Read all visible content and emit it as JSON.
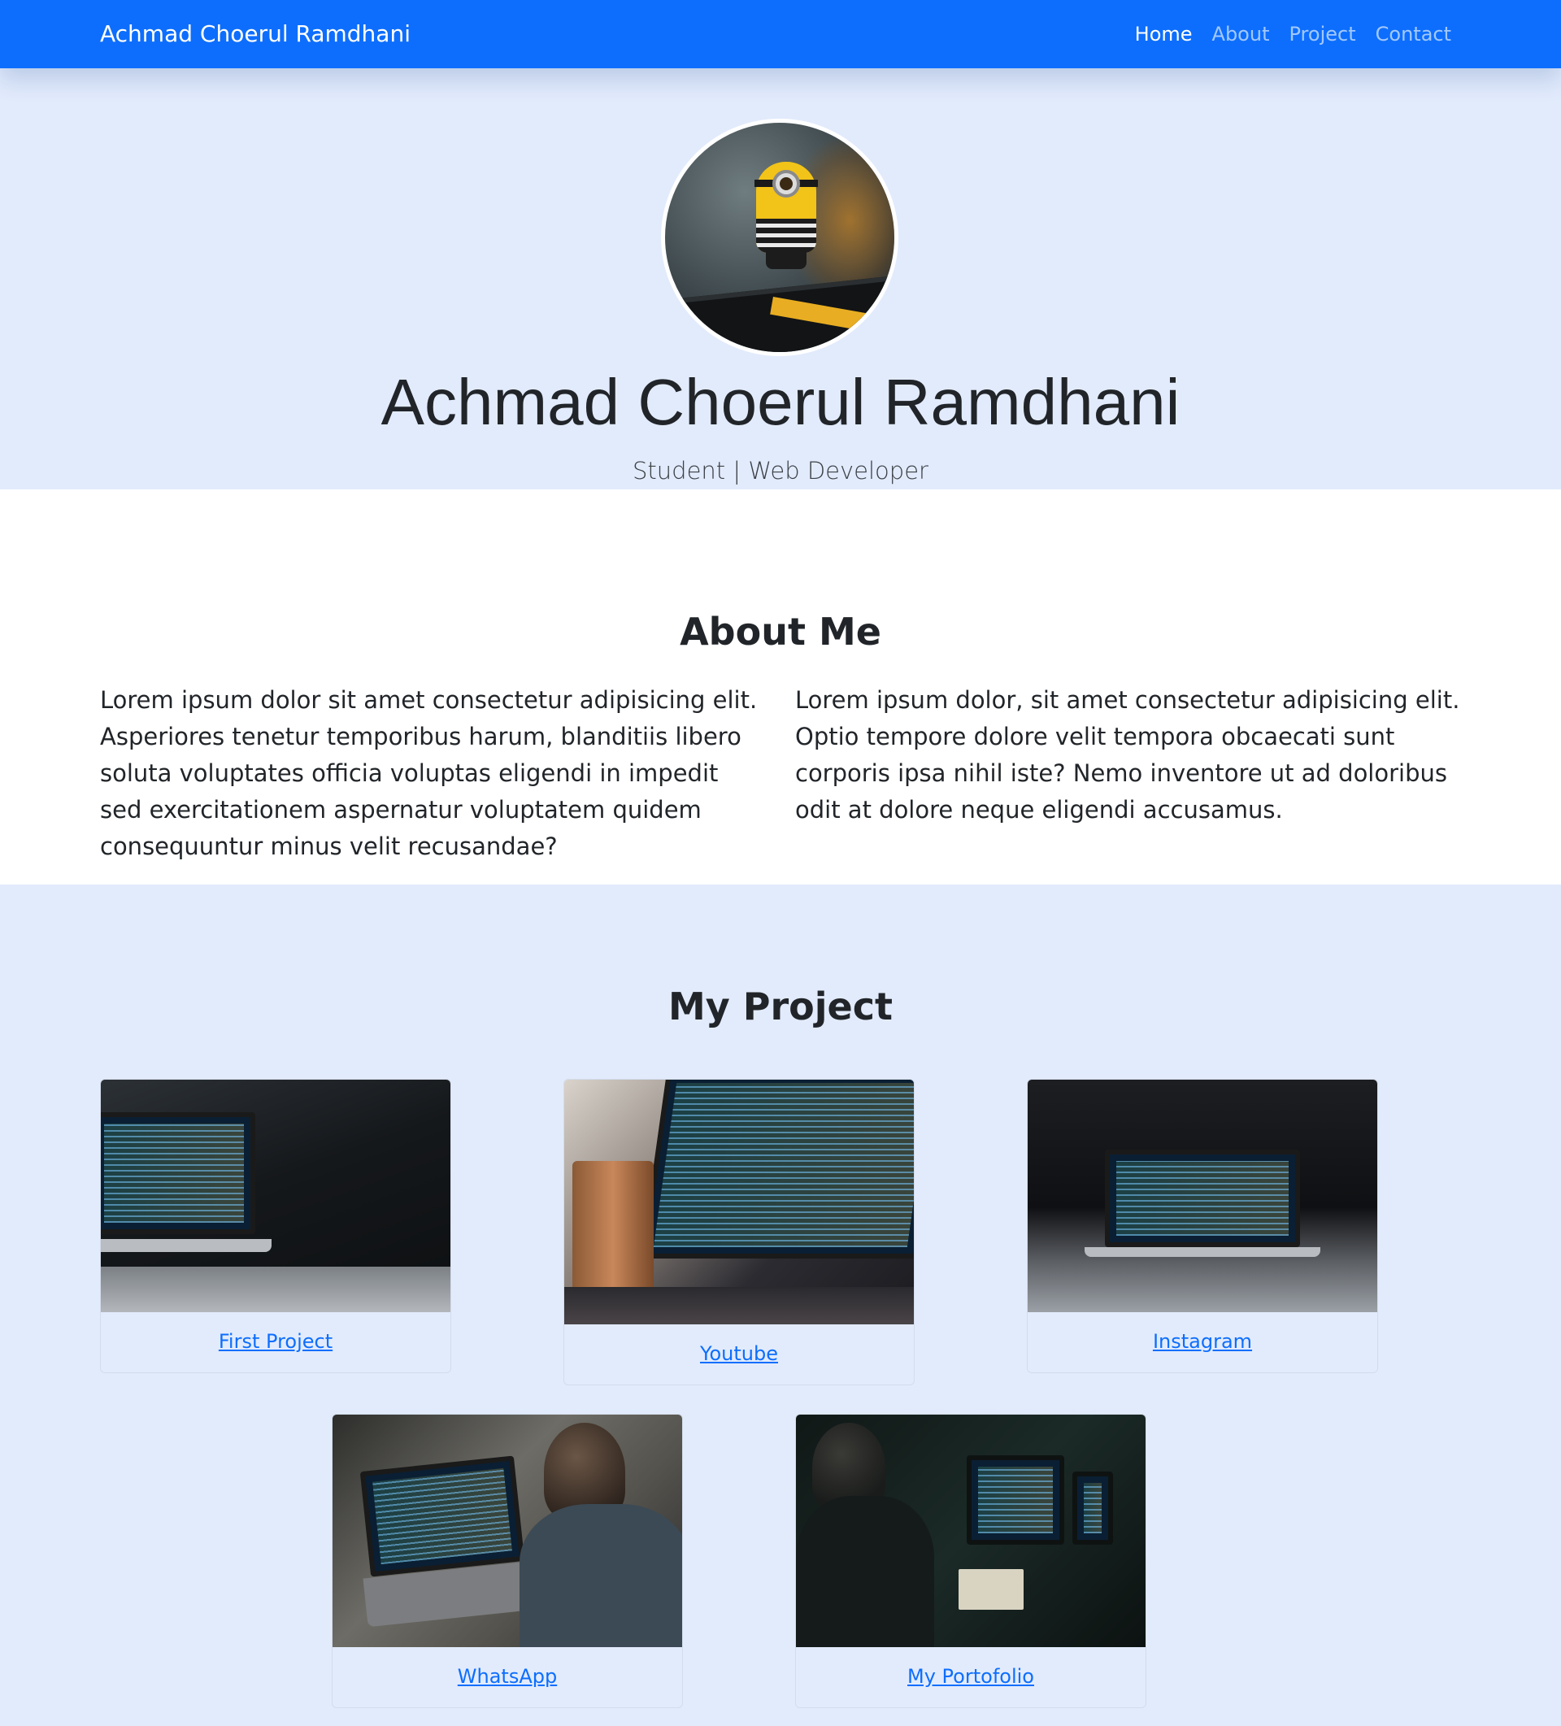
{
  "navbar": {
    "brand": "Achmad Choerul Ramdhani",
    "links": [
      "Home",
      "About",
      "Project",
      "Contact"
    ],
    "active": "Home",
    "color": "#0d6efd"
  },
  "hero": {
    "name": "Achmad Choerul Ramdhani",
    "subtitle": "Student | Web Developer",
    "background": "#e2ebfc"
  },
  "about": {
    "title": "About Me",
    "col_left": "Lorem ipsum dolor sit amet consectetur adipisicing elit. Asperiores tenetur temporibus harum, blanditiis libero soluta voluptates officia voluptas eligendi in impedit sed exercitationem aspernatur voluptatem quidem consequuntur minus velit recusandae?",
    "col_right": "Lorem ipsum dolor, sit amet consectetur adipisicing elit. Optio tempore dolore velit tempora obcaecati sunt corporis ipsa nihil iste? Nemo inventore ut ad doloribus odit at dolore neque eligendi accusamus."
  },
  "project": {
    "title": "My Project",
    "cards": [
      {
        "label": "First Project"
      },
      {
        "label": "Youtube"
      },
      {
        "label": "Instagram"
      },
      {
        "label": "WhatsApp"
      },
      {
        "label": "My Portofolio"
      }
    ]
  }
}
